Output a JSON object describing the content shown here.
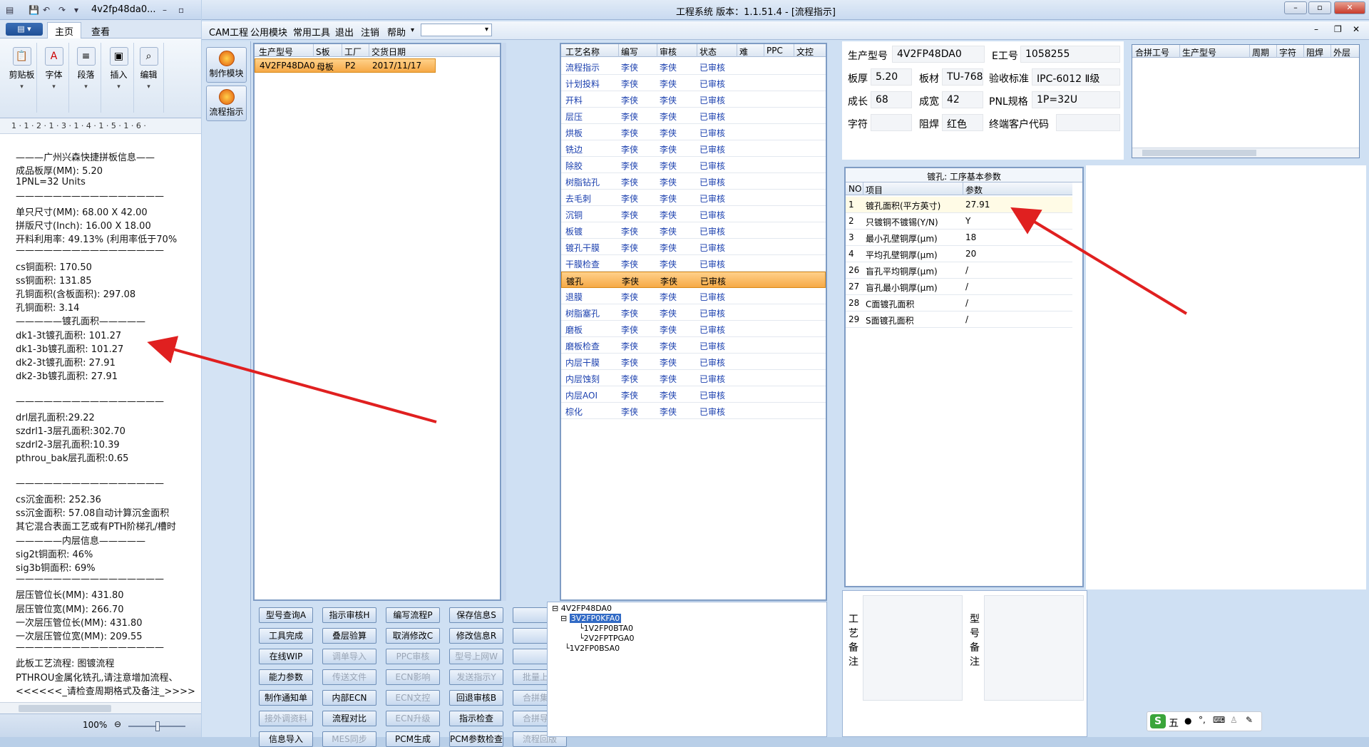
{
  "word": {
    "title": "4v2fp48da0...",
    "tabs": [
      "主页",
      "查看"
    ],
    "ribbon_groups": [
      "剪贴板",
      "字体",
      "段落",
      "插入",
      "编辑"
    ],
    "ruler": "1 · 1 · 2 · 1 · 3 · 1 · 4 · 1 · 5 · 1 · 6 ·",
    "zoom": "100%",
    "lines": [
      "———广州兴森快捷拼板信息——",
      "成品板厚(MM): 5.20",
      "1PNL=32 Units",
      "————————————————",
      "单只尺寸(MM): 68.00 X 42.00",
      "拼版尺寸(Inch): 16.00 X 18.00",
      "开料利用率: 49.13% (利用率低于70%",
      "————————————————",
      "cs铜面积: 170.50",
      "ss铜面积: 131.85",
      "孔铜面积(含板面积): 297.08",
      "孔铜面积: 3.14",
      "—————镀孔面积—————",
      "dk1-3t镀孔面积: 101.27",
      "dk1-3b镀孔面积: 101.27",
      "dk2-3t镀孔面积: 27.91",
      "dk2-3b镀孔面积: 27.91",
      "",
      "————————————————",
      "drl层孔面积:29.22",
      "szdrl1-3层孔面积:302.70",
      "szdrl2-3层孔面积:10.39",
      "pthrou_bak层孔面积:0.65",
      "",
      "————————————————",
      "cs沉金面积: 252.36",
      "ss沉金面积: 57.08自动计算沉金面积",
      "其它混合表面工艺或有PTH阶梯孔/槽时",
      "—————内层信息—————",
      "sig2t铜面积: 46%",
      "sig3b铜面积: 69%",
      "————————————————",
      "层压管位长(MM): 431.80",
      "层压管位宽(MM): 266.70",
      "一次层压管位长(MM): 431.80",
      "一次层压管位宽(MM): 209.55",
      "————————————————",
      "此板工艺流程: 图镀流程",
      "PTHROU金属化铣孔,请注意增加流程、",
      "<<<<<<_请检查周期格式及备注_>>>>"
    ]
  },
  "app": {
    "title": "工程系统  版本：1.1.51.4 - [流程指示]",
    "menus": [
      "CAM工程",
      "公用模块",
      "常用工具",
      "退出",
      "注销",
      "帮助"
    ],
    "nav": [
      "制作模块",
      "流程指示"
    ],
    "orders": {
      "headers": [
        "生产型号",
        "S板",
        "工厂",
        "交货日期"
      ],
      "rows": [
        [
          "4V2FP48DA0",
          "母板",
          "P2",
          "2017/11/17"
        ]
      ]
    },
    "process": {
      "headers": [
        "工艺名称",
        "编写",
        "审核",
        "状态",
        "难",
        "PPC",
        "文控"
      ],
      "rows": [
        [
          "流程指示",
          "李侠",
          "李侠",
          "已审核"
        ],
        [
          "计划投料",
          "李侠",
          "李侠",
          "已审核"
        ],
        [
          "开料",
          "李侠",
          "李侠",
          "已审核"
        ],
        [
          "层压",
          "李侠",
          "李侠",
          "已审核"
        ],
        [
          "烘板",
          "李侠",
          "李侠",
          "已审核"
        ],
        [
          "铣边",
          "李侠",
          "李侠",
          "已审核"
        ],
        [
          "除胶",
          "李侠",
          "李侠",
          "已审核"
        ],
        [
          "树脂钻孔",
          "李侠",
          "李侠",
          "已审核"
        ],
        [
          "去毛刺",
          "李侠",
          "李侠",
          "已审核"
        ],
        [
          "沉铜",
          "李侠",
          "李侠",
          "已审核"
        ],
        [
          "板镀",
          "李侠",
          "李侠",
          "已审核"
        ],
        [
          "镀孔干膜",
          "李侠",
          "李侠",
          "已审核"
        ],
        [
          "干膜检查",
          "李侠",
          "李侠",
          "已审核"
        ],
        [
          "镀孔",
          "李侠",
          "李侠",
          "已审核"
        ],
        [
          "退膜",
          "李侠",
          "李侠",
          "已审核"
        ],
        [
          "树脂塞孔",
          "李侠",
          "李侠",
          "已审核"
        ],
        [
          "磨板",
          "李侠",
          "李侠",
          "已审核"
        ],
        [
          "磨板检查",
          "李侠",
          "李侠",
          "已审核"
        ],
        [
          "内层干膜",
          "李侠",
          "李侠",
          "已审核"
        ],
        [
          "内层蚀刻",
          "李侠",
          "李侠",
          "已审核"
        ],
        [
          "内层AOI",
          "李侠",
          "李侠",
          "已审核"
        ],
        [
          "棕化",
          "李侠",
          "李侠",
          "已审核"
        ]
      ],
      "selected_index": 13
    },
    "info": {
      "fields": [
        {
          "label": "生产型号",
          "value": "4V2FP48DA0"
        },
        {
          "label": "E工号",
          "value": "1058255"
        },
        {
          "label": "板厚",
          "value": "5.20"
        },
        {
          "label": "板材",
          "value": "TU-768"
        },
        {
          "label": "验收标准",
          "value": "IPC-6012 Ⅱ级"
        },
        {
          "label": "成长",
          "value": "68"
        },
        {
          "label": "成宽",
          "value": "42"
        },
        {
          "label": "PNL规格",
          "value": "1P=32U"
        },
        {
          "label": "字符",
          "value": ""
        },
        {
          "label": "阻焊",
          "value": "红色"
        },
        {
          "label": "终端客户代码",
          "value": ""
        }
      ]
    },
    "merge": {
      "headers": [
        "合拼工号",
        "生产型号",
        "周期",
        "字符",
        "阻焊",
        "外层"
      ]
    },
    "params": {
      "title": "镀孔: 工序基本参数",
      "headers": [
        "NO",
        "项目",
        "参数"
      ],
      "rows": [
        [
          "1",
          "镀孔面积(平方英寸)",
          "27.91"
        ],
        [
          "2",
          "只镀铜不镀锡(Y/N)",
          "Y"
        ],
        [
          "3",
          "最小孔壁铜厚(μm)",
          "18"
        ],
        [
          "4",
          "平均孔壁铜厚(μm)",
          "20"
        ],
        [
          "26",
          "盲孔平均铜厚(μm)",
          "/"
        ],
        [
          "27",
          "盲孔最小铜厚(μm)",
          "/"
        ],
        [
          "28",
          "C面镀孔面积",
          "/"
        ],
        [
          "29",
          "S面镀孔面积",
          "/"
        ]
      ]
    },
    "remarks": {
      "process_label": "工艺备注",
      "model_label": "型号备注"
    },
    "buttons": [
      [
        "型号查询A",
        "指示审核H",
        "编写流程P",
        "保存信息S",
        ""
      ],
      [
        "工具完成",
        "叠层验算",
        "取消修改C",
        "修改信息R",
        ""
      ],
      [
        "在线WIP",
        "调单导入",
        "PPC审核",
        "型号上网W",
        ""
      ],
      [
        "能力参数",
        "传送文件",
        "ECN影响",
        "发送指示Y",
        "批量上网"
      ],
      [
        "制作通知单",
        "内部ECN",
        "ECN文控",
        "回退审核B",
        "合拼集成"
      ],
      [
        "接外调资料",
        "流程对比",
        "ECN升级",
        "指示检查",
        "合拼导入"
      ],
      [
        "信息导入",
        "MES同步",
        "PCM生成",
        "PCM参数检查",
        "流程回版"
      ]
    ],
    "disabled_buttons": [
      "调单导入",
      "PPC审核",
      "型号上网W",
      "传送文件",
      "ECN影响",
      "发送指示Y",
      "批量上网",
      "ECN文控",
      "合拼集成",
      "接外调资料",
      "ECN升级",
      "合拼导入",
      "MES同步",
      "流程回版"
    ],
    "tree": [
      "4V2FP48DA0",
      "3V2FP0KFA0",
      "1V2FP0BTA0",
      "2V2FPTPGA0",
      "1V2FP0BSA0"
    ],
    "ime": "五",
    "colors": {
      "arrow": "#e02020",
      "selection": "#f6a946",
      "link_text": "#1a3fae"
    }
  }
}
